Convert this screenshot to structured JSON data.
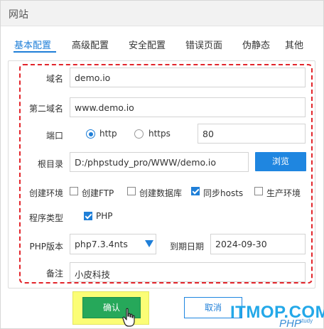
{
  "window": {
    "title": "网站"
  },
  "tabs": [
    {
      "label": "基本配置",
      "active": true
    },
    {
      "label": "高级配置"
    },
    {
      "label": "安全配置"
    },
    {
      "label": "错误页面"
    },
    {
      "label": "伪静态"
    },
    {
      "label": "其他"
    }
  ],
  "form": {
    "domain": {
      "label": "域名",
      "value": "demo.io"
    },
    "second_domain": {
      "label": "第二域名",
      "value": "www.demo.io"
    },
    "port": {
      "label": "端口",
      "options": [
        {
          "label": "http",
          "checked": true
        },
        {
          "label": "https",
          "checked": false
        }
      ],
      "value": "80"
    },
    "root": {
      "label": "根目录",
      "value": "D:/phpstudy_pro/WWW/demo.io",
      "browse_label": "浏览"
    },
    "env": {
      "label": "创建环境",
      "options": [
        {
          "label": "创建FTP",
          "checked": false
        },
        {
          "label": "创建数据库",
          "checked": false
        },
        {
          "label": "同步hosts",
          "checked": true
        },
        {
          "label": "生产环境",
          "checked": false
        }
      ]
    },
    "program_type": {
      "label": "程序类型",
      "option": {
        "label": "PHP",
        "checked": true
      }
    },
    "php_version": {
      "label": "PHP版本",
      "value": "php7.3.4nts"
    },
    "expire": {
      "label": "到期日期",
      "value": "2024-09-30"
    },
    "note": {
      "label": "备注",
      "value": "小皮科技"
    }
  },
  "buttons": {
    "confirm": "确认",
    "cancel": "取消"
  },
  "watermark": {
    "main": "ITMOP.COM",
    "sub": "PHP",
    "small": "study"
  },
  "colors": {
    "accent": "#1f7fd8",
    "confirm": "#26a85a",
    "highlight_dash": "#e2252b"
  }
}
